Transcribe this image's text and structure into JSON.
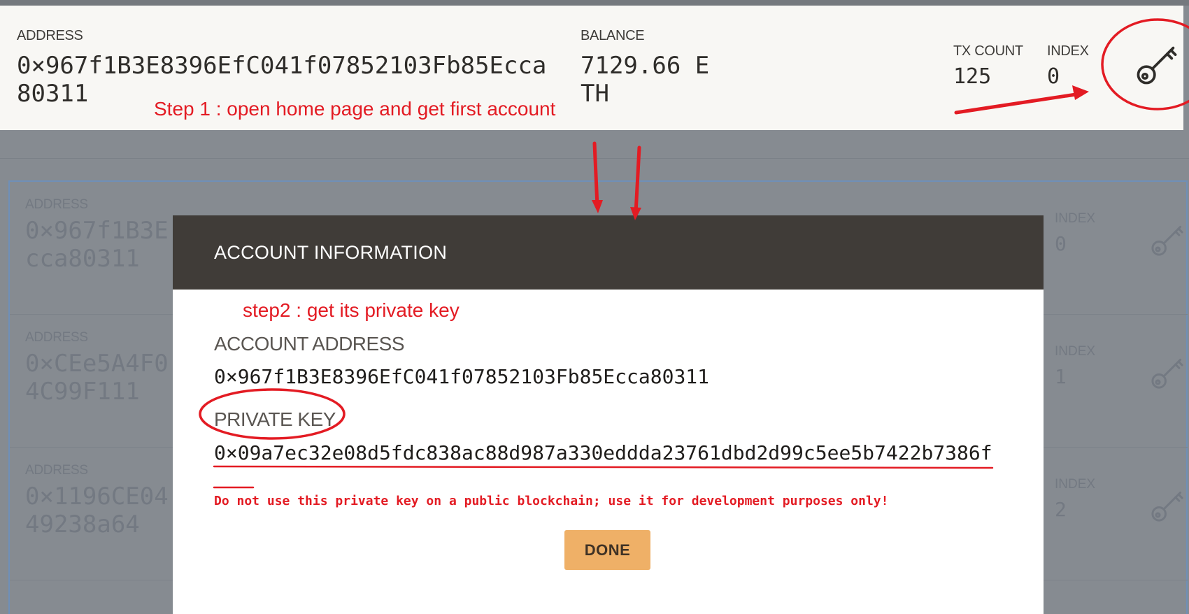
{
  "top_account": {
    "address_label": "ADDRESS",
    "address": "0×967f1B3E8396EfC041f07852103Fb85Ecca80311",
    "balance_label": "BALANCE",
    "balance": "7129.66 ETH",
    "tx_count_label": "TX COUNT",
    "tx_count": "125",
    "index_label": "INDEX",
    "index": "0",
    "key_icon": "key-icon"
  },
  "background_accounts": [
    {
      "address_label": "ADDRESS",
      "address": "0×967f1B3E\ncca80311",
      "index_label": "INDEX",
      "index": "0"
    },
    {
      "address_label": "ADDRESS",
      "address": "0×CEe5A4F0\n4C99F111",
      "index_label": "INDEX",
      "index": "1"
    },
    {
      "address_label": "ADDRESS",
      "address": "0×1196CE04\n49238a64",
      "index_label": "INDEX",
      "index": "2"
    }
  ],
  "annotations": {
    "step1": "Step 1 : open home page and get first account",
    "step2": "step2 : get its private key",
    "annotation_color": "#e31b23"
  },
  "modal": {
    "title": "ACCOUNT INFORMATION",
    "account_address_label": "ACCOUNT ADDRESS",
    "account_address": "0×967f1B3E8396EfC041f07852103Fb85Ecca80311",
    "private_key_label": "PRIVATE KEY",
    "private_key": "0×09a7ec32e08d5fdc838ac88d987a330eddda23761dbd2d99c5ee5b7422b7386f",
    "warning": "Do not use this private key on a public blockchain; use it for development purposes only!",
    "done_label": "DONE",
    "accent_color": "#efb067"
  }
}
